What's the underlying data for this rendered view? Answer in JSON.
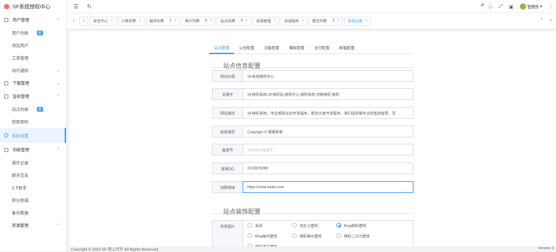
{
  "app": {
    "title": "SF系统授权中心"
  },
  "sidebar": {
    "groups": [
      {
        "label": "用户管理",
        "items": [
          {
            "label": "用户列表",
            "badge": "新"
          },
          {
            "label": "添加用户"
          },
          {
            "label": "工单管理"
          },
          {
            "label": "站内通知"
          }
        ]
      },
      {
        "label": "下载管理"
      },
      {
        "label": "监权管理",
        "items": [
          {
            "label": "站点列表",
            "badge": "新"
          },
          {
            "label": "获取密码"
          }
        ]
      },
      {
        "label": "系统设置"
      },
      {
        "label": "功能管理",
        "items": [
          {
            "label": "操作记录"
          },
          {
            "label": "聊天交友"
          },
          {
            "label": "S F助手"
          },
          {
            "label": "积分商城"
          },
          {
            "label": "备份数据"
          },
          {
            "label": "资源管理"
          }
        ]
      }
    ]
  },
  "topbar": {
    "user": "管理员"
  },
  "tabs": [
    {
      "label": "安全中心"
    },
    {
      "label": "订单列表"
    },
    {
      "label": "程序列表",
      "count": "1"
    },
    {
      "label": "用户列表",
      "count": "0"
    },
    {
      "label": "站点列表",
      "count": "0"
    },
    {
      "label": "资源管理"
    },
    {
      "label": "添加程序"
    },
    {
      "label": "模式列表",
      "count": "2"
    },
    {
      "label": "系统设置"
    }
  ],
  "subtabs": [
    "站点配置",
    "公告配置",
    "功能配置",
    "模板配置",
    "支付配置",
    "邮箱配置"
  ],
  "sections": {
    "site_info": "站点信息配置",
    "site_decor": "站点装饰配置"
  },
  "form": [
    {
      "label": "网站标题",
      "value": "SF系统授权中心"
    },
    {
      "label": "关键字",
      "value": "SF授权系统,SF授权站,授权中心,授权系统,代刷授权,授权"
    },
    {
      "label": "网站描述",
      "value": "SF授权系统，专业帮助站长开发程序，帮您大家开发程序，我们提供最专业的售前指导，至"
    },
    {
      "label": "底部版权",
      "value": "Copyright © 嗯嗯泉商"
    },
    {
      "label": "备案号",
      "placeholder": "添加你的备案号"
    },
    {
      "label": "客服QQ",
      "value": "2129876388"
    },
    {
      "label": "加群链接",
      "value": "https://www.baidu.com"
    }
  ],
  "background": {
    "label": "背景图片",
    "options": [
      "关闭",
      "自定义壁纸",
      "Bing随机壁纸",
      "Bing每日壁纸",
      "随机美女壁纸",
      "随机二次元壁纸",
      "随机汽车壁纸"
    ],
    "selected": "Bing随机壁纸"
  },
  "footer": {
    "copyright": "Copyright © 2023 SF-赞上开开 All Rights Reserved.",
    "version": "Version 3"
  }
}
